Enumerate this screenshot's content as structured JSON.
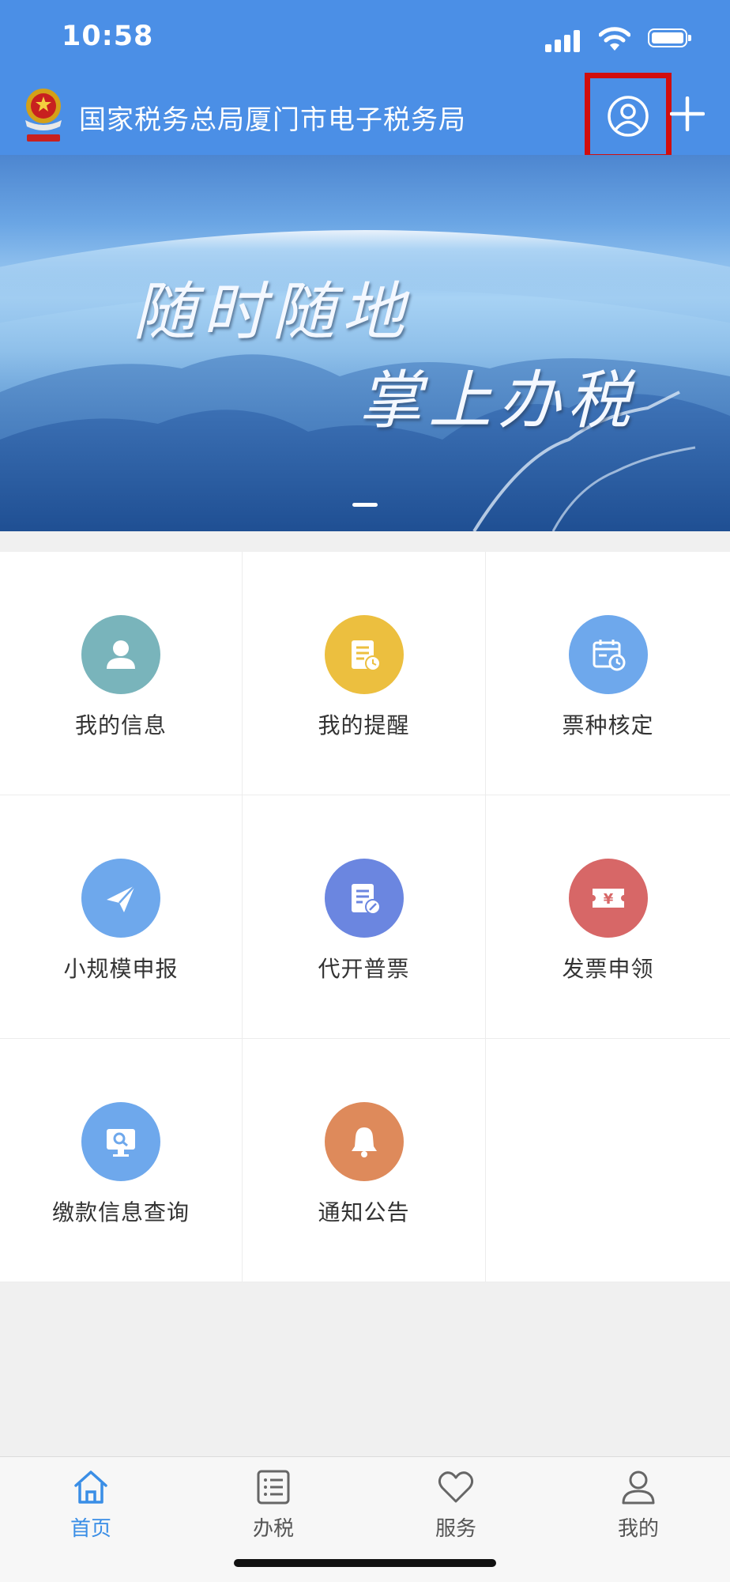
{
  "status_bar": {
    "time": "10:58"
  },
  "header": {
    "title": "国家税务总局厦门市电子税务局",
    "emblem_icon": "national-tax-emblem-icon",
    "account_icon": "user-account-icon",
    "plus_icon": "plus-icon"
  },
  "banner": {
    "line1": "随时随地",
    "line2": "掌上办税"
  },
  "grid": {
    "items": [
      {
        "label": "我的信息",
        "icon": "person-icon",
        "color": "#79b4bb"
      },
      {
        "label": "我的提醒",
        "icon": "reminder-document-icon",
        "color": "#ecbf3f"
      },
      {
        "label": "票种核定",
        "icon": "calendar-clock-icon",
        "color": "#6ea8ec"
      },
      {
        "label": "小规模申报",
        "icon": "paper-plane-icon",
        "color": "#6ea8ec"
      },
      {
        "label": "代开普票",
        "icon": "invoice-edit-icon",
        "color": "#6b86e0"
      },
      {
        "label": "发票申领",
        "icon": "yen-ticket-icon",
        "color": "#d76767"
      },
      {
        "label": "缴款信息查询",
        "icon": "monitor-search-icon",
        "color": "#6ea8ec"
      },
      {
        "label": "通知公告",
        "icon": "bell-icon",
        "color": "#de8a5b"
      }
    ]
  },
  "tabbar": {
    "tabs": [
      {
        "label": "首页",
        "icon": "home-icon",
        "active": true
      },
      {
        "label": "办税",
        "icon": "list-icon",
        "active": false
      },
      {
        "label": "服务",
        "icon": "heart-icon",
        "active": false
      },
      {
        "label": "我的",
        "icon": "person-outline-icon",
        "active": false
      }
    ],
    "active_color": "#3a8ee6"
  },
  "colors": {
    "header_bg": "#4b8fe6",
    "highlight_box": "#d10d0d"
  }
}
